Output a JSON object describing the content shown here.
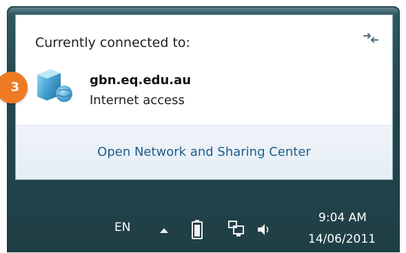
{
  "popup": {
    "header": "Currently connected to:",
    "network_name": "gbn.eq.edu.au",
    "network_status": "Internet access",
    "link_label": "Open Network and Sharing Center"
  },
  "badge": {
    "number": "3",
    "color": "#ef7a24"
  },
  "taskbar": {
    "language": "EN",
    "time": "9:04 AM",
    "date": "14/06/2011"
  },
  "icons": {
    "refresh": "refresh-icon",
    "network": "network-globe-icon",
    "show_hidden": "show-hidden-icons-arrow",
    "battery": "battery-icon",
    "tray_network": "network-tray-icon",
    "volume": "volume-icon"
  },
  "colors": {
    "link": "#1f5c8a",
    "frame": "#24474e",
    "badge": "#ef7a24"
  }
}
